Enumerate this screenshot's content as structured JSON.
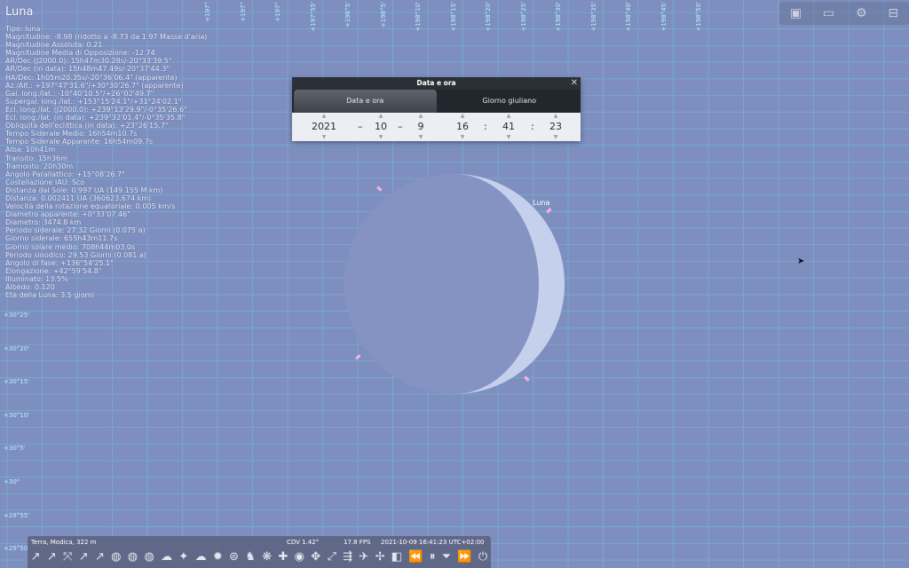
{
  "object": {
    "name": "Luna",
    "lines": [
      "Tipo: luna",
      "Magnitudine: -8.98 (ridotto a -8.73 da 1.97 Masse d'aria)",
      "Magnitudine Assoluta: 0.21",
      "Magnitudine Media di Opposizione: -12.74",
      "AR/Dec (J2000.0): 15h47m30.28s/-20°33'39.5\"",
      "AR/Dec (in data): 15h48m47.49s/-20°37'44.3\"",
      "HA/Dec: 1h05m20.35s/-20°36'06.4\" (apparente)",
      "Az./Alt.: +197°47'31.6\"/+30°30'26.7\" (apparente)",
      "Gal. long./lat.: -10°40'10.5\"/+26°02'49.7\"",
      "Supergal. long./lat.: +153°15'24.1\"/+31°24'02.1\"",
      "Ecl. long./lat. (J2000.0): +239°13'29.9\"/-0°35'26.6\"",
      "Ecl. long./lat. (in data): +239°32'01.4\"/-0°35'35.8\"",
      "Obliquità dell'eclittica (in data): +23°26'15.7\"",
      "Tempo Siderale Medio: 16h54m10.7s",
      "Tempo Siderale Apparente: 16h54m09.7s",
      "Alba: 10h41m",
      "Transito: 15h36m",
      "Tramonto: 20h30m",
      "Angolo Parallattico: +15°08'26.7\"",
      "Costellazione IAU: Sco",
      "Distanza dal Sole: 0.997 UA (149.155 M km)",
      "Distanza: 0.002411 UA (360623.674 km)",
      "Velocità della rotazione equatoriale: 0.005 km/s",
      "Diametro apparente: +0°33'07.46\"",
      "Diametro: 3474.8 km",
      "Periodo siderale: 27.32 Giorni (0.075 a)",
      "Giorno siderale: 655h43m11.7s",
      "Giorno solare medio: 708h44m03.0s",
      "Periodo sinodico: 29.53 Giorni (0.081 a)",
      "Angolo di fase: +136°54'25.1\"",
      "Elongazione: +42°59'54.8\"",
      "Illuminato: 13.5%",
      "Albedo: 0.120",
      "Età della Luna: 3.5 giorni"
    ]
  },
  "grid_labels_left": [
    "+30°25'",
    "+30°20'",
    "+30°15'",
    "+30°10'",
    "+30°5'",
    "+30°",
    "+29°55'",
    "+29°50'"
  ],
  "grid_labels_top": [
    "+197°",
    "+197°",
    "+197°",
    "+197°55'",
    "+198°5'",
    "+198°5'",
    "+198°10'",
    "+198°15'",
    "+198°20'",
    "+198°25'",
    "+198°30'",
    "+198°35'",
    "+198°40'",
    "+198°45'",
    "+198°50'"
  ],
  "dialog": {
    "title": "Data e ora",
    "close": "✕",
    "tab_date": "Data e ora",
    "tab_julian": "Giorno giuliano",
    "year": "2021",
    "month": "10",
    "day": "9",
    "date_sep": "–",
    "hour": "16",
    "minute": "41",
    "second": "23",
    "time_sep": ":",
    "arrow_up": "▲",
    "arrow_down": "▼"
  },
  "moon_label": "Luna",
  "status": {
    "location": "Terra, Modica, 322 m",
    "fov": "CDV 1.42°",
    "fps": "17.8 FPS",
    "datetime": "2021-10-09 16:41:23 UTC+02:00"
  },
  "icons": [
    "↗",
    "↗",
    "⤧",
    "↗",
    "↗",
    "◍",
    "◍",
    "◍",
    "☁",
    "✦",
    "☁",
    "✹",
    "⊚",
    "♞",
    "❋",
    "✚",
    "◉",
    "✥",
    "⤢",
    "⇶",
    "✈",
    "✢",
    "◧",
    "⏪",
    "⏸",
    "⏷",
    "⏩",
    "⏻"
  ],
  "topright_icons": [
    "▣",
    "▭",
    "⚙",
    "⊟"
  ],
  "colors": {
    "sky": "#7e8fbf",
    "grid": "#63d8f0",
    "moon_lit": "#c5d0ec",
    "moon_dark": "#8593c3",
    "pink_marker": "#ffb0e0"
  }
}
